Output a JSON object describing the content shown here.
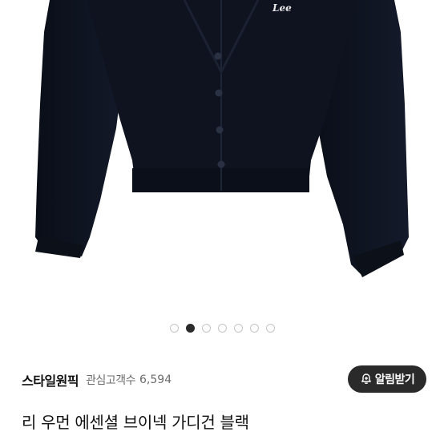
{
  "image": {
    "brand_logo": "Lee",
    "garment_color": "#0f1320"
  },
  "carousel": {
    "dots": [
      {
        "active": false
      },
      {
        "active": true
      },
      {
        "active": false
      },
      {
        "active": false
      },
      {
        "active": false
      },
      {
        "active": false
      },
      {
        "active": false
      }
    ]
  },
  "store": {
    "name": "스타일원픽",
    "interest_label": "관심고객수",
    "interest_count": "6,594",
    "alert_button_label": "알림받기",
    "alert_icon": "bell-plus-icon"
  },
  "product": {
    "title": "리 우먼 에센셜 브이넥 가디건 블랙"
  }
}
